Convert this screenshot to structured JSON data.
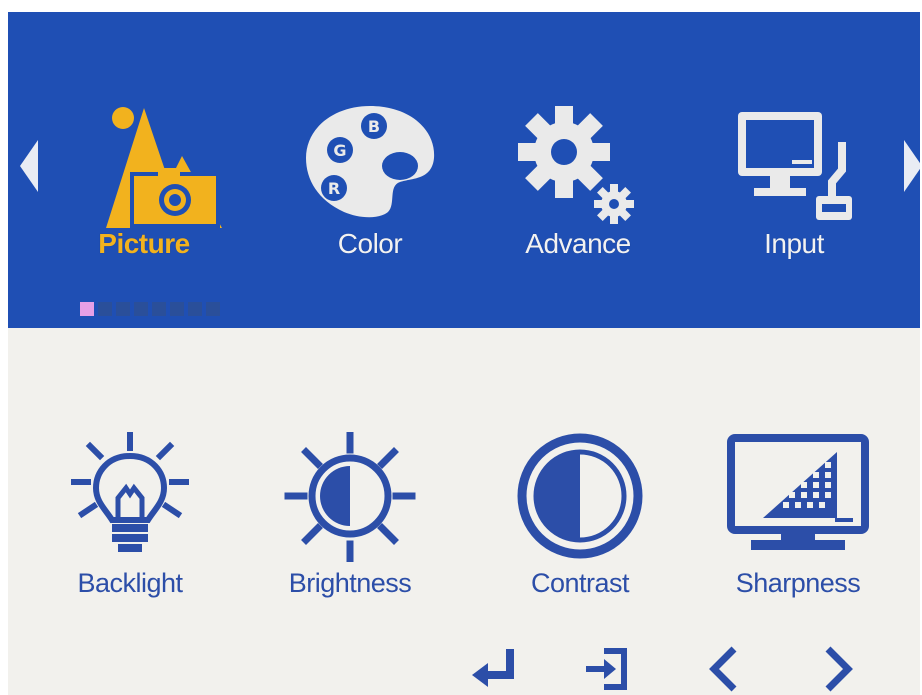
{
  "menu": {
    "tabs": [
      {
        "label": "Picture",
        "icon": "picture-icon",
        "active": true
      },
      {
        "label": "Color",
        "icon": "palette-icon"
      },
      {
        "label": "Advance",
        "icon": "gear-icon"
      },
      {
        "label": "Input",
        "icon": "input-monitor-icon"
      }
    ],
    "palette_letters": {
      "b": "B",
      "g": "G",
      "r": "R"
    }
  },
  "items": [
    {
      "label": "Backlight",
      "icon": "lightbulb-icon"
    },
    {
      "label": "Brightness",
      "icon": "sun-icon"
    },
    {
      "label": "Contrast",
      "icon": "contrast-icon"
    },
    {
      "label": "Sharpness",
      "icon": "sharpness-monitor-icon"
    }
  ],
  "footer": {
    "buttons": [
      "enter-icon",
      "exit-icon",
      "chevron-left-icon",
      "chevron-right-icon"
    ]
  },
  "colors": {
    "band": "#1f4fb4",
    "panel": "#f2f1ed",
    "active_tab": "#f2b21e",
    "item_blue": "#2c4ea8",
    "page_current": "#e6a0e6"
  },
  "pager": {
    "current": 1,
    "total": 8
  }
}
